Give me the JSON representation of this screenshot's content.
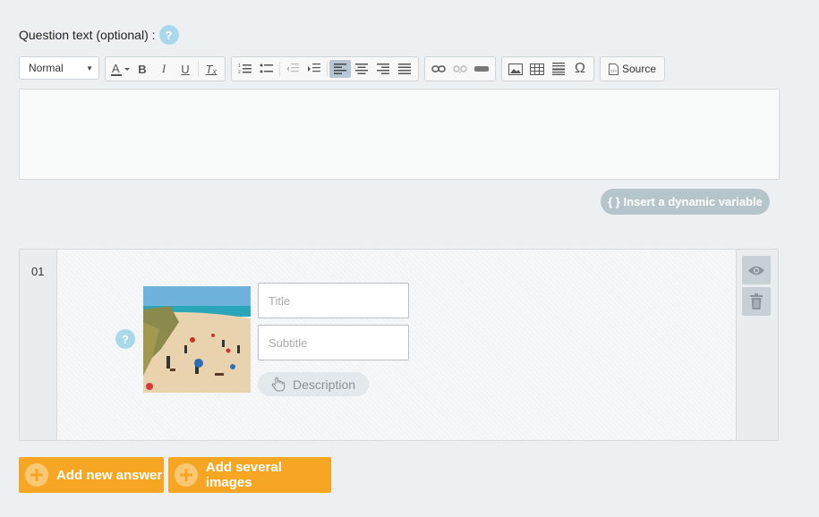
{
  "question": {
    "label": "Question text (optional) :",
    "help_glyph": "?"
  },
  "toolbar": {
    "format_value": "Normal",
    "source_label": "Source",
    "icons": [
      "font-color",
      "bold",
      "italic",
      "underline",
      "remove-format",
      "numbered-list",
      "bulleted-list",
      "outdent",
      "indent",
      "align-left",
      "align-center",
      "align-right",
      "justify",
      "link",
      "unlink",
      "anchor",
      "image",
      "table",
      "horizontal-rule",
      "special-char",
      "source"
    ]
  },
  "dynamic_variable": {
    "label": "{ } Insert a dynamic variable"
  },
  "answer": {
    "number": "01",
    "title_placeholder": "Title",
    "subtitle_placeholder": "Subtitle",
    "description_label": "Description",
    "help_glyph": "?"
  },
  "actions": {
    "add_answer_label": "Add new answer",
    "add_images_label": "Add several images"
  },
  "colors": {
    "accent_orange": "#f6a623",
    "help_blue": "#a8d8ea",
    "pill_grey": "#b6c5cc"
  }
}
